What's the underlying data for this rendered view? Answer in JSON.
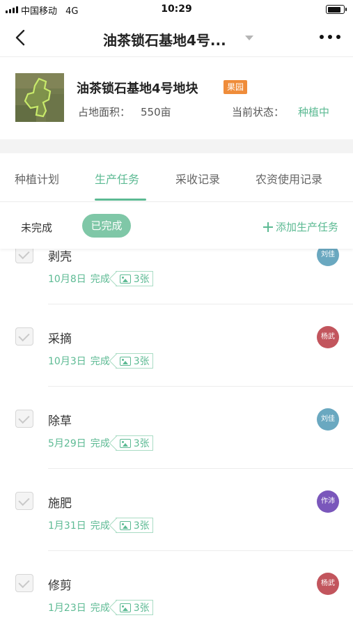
{
  "status_bar": {
    "carrier": "中国移动",
    "network": "4G",
    "time": "10:29",
    "battery_level": 0.85
  },
  "nav": {
    "title": "油茶锁石基地4号...",
    "back_icon": "chevron-left-icon",
    "more_icon": "more-dots-icon"
  },
  "plot": {
    "name": "油茶锁石基地4号地块",
    "tag": "果园",
    "tag_color": "#ef8c3a",
    "area_label": "占地面积：",
    "area_value": "550亩",
    "status_label": "当前状态：",
    "status_value": "种植中"
  },
  "tabs": [
    {
      "label": "种植计划",
      "active": false
    },
    {
      "label": "生产任务",
      "active": true
    },
    {
      "label": "采收记录",
      "active": false
    },
    {
      "label": "农资使用记录",
      "active": false
    }
  ],
  "filter": {
    "undone_label": "未完成",
    "done_label": "已完成",
    "add_label": "添加生产任务"
  },
  "tasks": [
    {
      "name": "剥壳",
      "date": "10月8日",
      "status": "完成",
      "photos": "3张",
      "assignee": "刘佳",
      "avatar_color": "#6aa8c0"
    },
    {
      "name": "采摘",
      "date": "10月3日",
      "status": "完成",
      "photos": "3张",
      "assignee": "杨武",
      "avatar_color": "#c2555d"
    },
    {
      "name": "除草",
      "date": "5月29日",
      "status": "完成",
      "photos": "3张",
      "assignee": "刘佳",
      "avatar_color": "#6aa8c0"
    },
    {
      "name": "施肥",
      "date": "1月31日",
      "status": "完成",
      "photos": "3张",
      "assignee": "作沛",
      "avatar_color": "#7a57bb"
    },
    {
      "name": "修剪",
      "date": "1月23日",
      "status": "完成",
      "photos": "3张",
      "assignee": "杨武",
      "avatar_color": "#c2555d"
    }
  ],
  "colors": {
    "accent": "#5cba93",
    "accent_light": "#7fc7a7"
  }
}
